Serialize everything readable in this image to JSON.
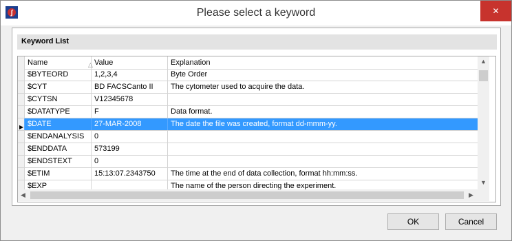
{
  "window": {
    "title": "Please select a keyword",
    "close_glyph": "✕"
  },
  "group": {
    "label": "Keyword List"
  },
  "grid": {
    "columns": [
      "Name",
      "Value",
      "Explanation"
    ],
    "sort_indicator": "△",
    "selected_row_marker": "▶",
    "rows": [
      {
        "name": "$BYTEORD",
        "value": "1,2,3,4",
        "explanation": "Byte Order"
      },
      {
        "name": "$CYT",
        "value": "BD FACSCanto II",
        "explanation": "The cytometer used to acquire the data."
      },
      {
        "name": "$CYTSN",
        "value": "V12345678",
        "explanation": ""
      },
      {
        "name": "$DATATYPE",
        "value": "F",
        "explanation": "Data format."
      },
      {
        "name": "$DATE",
        "value": "27-MAR-2008",
        "explanation": "The date the file was created, format dd-mmm-yy."
      },
      {
        "name": "$ENDANALYSIS",
        "value": "0",
        "explanation": ""
      },
      {
        "name": "$ENDDATA",
        "value": "573199",
        "explanation": ""
      },
      {
        "name": "$ENDSTEXT",
        "value": "0",
        "explanation": ""
      },
      {
        "name": "$ETIM",
        "value": "15:13:07.2343750",
        "explanation": "The time at the end of data collection, format hh:mm:ss."
      },
      {
        "name": "$EXP",
        "value": "",
        "explanation": "The name of the person directing the experiment."
      }
    ]
  },
  "buttons": {
    "ok": "OK",
    "cancel": "Cancel"
  },
  "colors": {
    "selection": "#3399ff",
    "close": "#c7332d"
  },
  "icons": {
    "app": "app-logo-icon",
    "close": "close-icon"
  }
}
